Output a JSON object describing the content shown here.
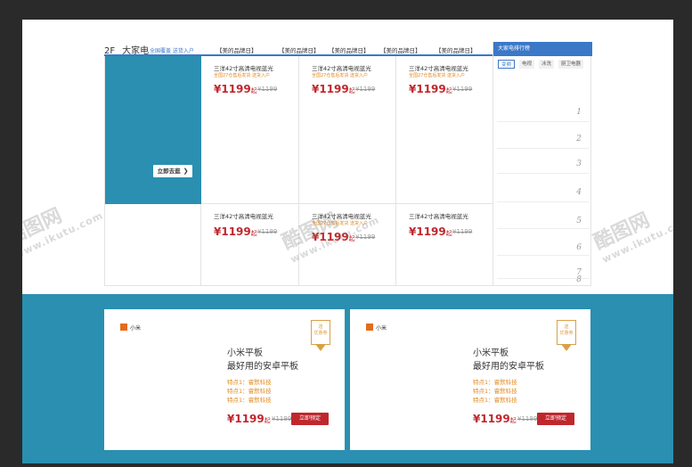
{
  "floor": {
    "number": "2F",
    "title": "大家电",
    "subtitle": "全国覆盖  送货入户",
    "tabs": [
      "【美的品牌日】",
      "【美的品牌日】",
      "【美的品牌日】",
      "【美的品牌日】",
      "【美的品牌日】"
    ]
  },
  "promo": {
    "button_label": "立即去逛",
    "button_icon": "chevron-right-icon"
  },
  "products": [
    {
      "name": "三洋42寸高清电视蓝光",
      "desc": "全国27仓售后发货 送货入户",
      "price": "¥1199",
      "price_suffix": "起",
      "old_price": "¥1199"
    },
    {
      "name": "三洋42寸高清电视蓝光",
      "desc": "全国27仓售后发货 送货入户",
      "price": "¥1199",
      "price_suffix": "起",
      "old_price": "¥1199"
    },
    {
      "name": "三洋42寸高清电视蓝光",
      "desc": "全国27仓售后发货 送货入户",
      "price": "¥1199",
      "price_suffix": "起",
      "old_price": "¥1199"
    },
    {
      "name": "三洋42寸高清电视蓝光",
      "desc": "",
      "price": "¥1199",
      "price_suffix": "起",
      "old_price": "¥1199"
    },
    {
      "name": "三洋42寸高清电视蓝光",
      "desc": "全国27仓售后发货 送货入户",
      "price": "¥1199",
      "price_suffix": "起",
      "old_price": "¥1199"
    },
    {
      "name": "三洋42寸高清电视蓝光",
      "desc": "",
      "price": "¥1199",
      "price_suffix": "起",
      "old_price": "¥1199"
    }
  ],
  "ranking": {
    "title": "大家电排行榜",
    "tabs": [
      "变频",
      "电视",
      "冰洗",
      "厨卫电器"
    ],
    "numbers": [
      "1",
      "2",
      "3",
      "4",
      "5",
      "6",
      "7",
      "8"
    ]
  },
  "cards": [
    {
      "brand": "小米",
      "coupon": "送\n优惠券",
      "coupon_line1": "送",
      "coupon_line2": "优惠券",
      "title_line1": "小米平板",
      "title_line2": "最好用的安卓平板",
      "features": [
        "特点1：睿默科技",
        "特点1：睿默科技",
        "特点1：睿默科技"
      ],
      "price": "¥1199",
      "price_suffix": "起",
      "old_price": "¥1199",
      "button_label": "立即预定"
    },
    {
      "brand": "小米",
      "coupon_line1": "送",
      "coupon_line2": "优惠券",
      "title_line1": "小米平板",
      "title_line2": "最好用的安卓平板",
      "features": [
        "特点1：睿默科技",
        "特点1：睿默科技",
        "特点1：睿默科技"
      ],
      "price": "¥1199",
      "price_suffix": "起",
      "old_price": "¥1199",
      "button_label": "立即预定"
    }
  ],
  "watermark": {
    "logo_text": "酷图网",
    "url": "www.ikutu.com"
  },
  "colors": {
    "accent_blue": "#3b78c8",
    "teal": "#2a8fb0",
    "price_red": "#c0272d",
    "feature_orange": "#e08a1e",
    "brand_orange": "#e66b1b"
  }
}
